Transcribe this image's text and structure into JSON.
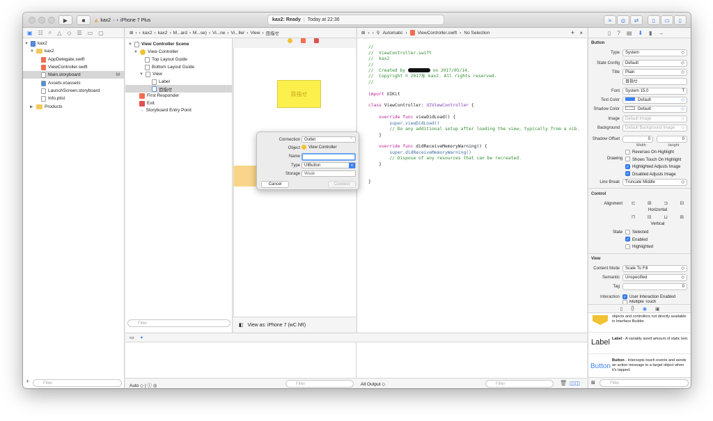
{
  "toolbar": {
    "scheme_app": "kax2",
    "scheme_device": "iPhone 7 Plus",
    "status_app": "kax2: Ready",
    "status_time": "Today at 22:36"
  },
  "navigator": {
    "items": [
      {
        "label": "kax2",
        "level": 0
      },
      {
        "label": "kax2",
        "level": 1
      },
      {
        "label": "AppDelegate.swift",
        "level": 2
      },
      {
        "label": "ViewController.swift",
        "level": 2
      },
      {
        "label": "Main.storyboard",
        "level": 2,
        "badge": "M"
      },
      {
        "label": "Assets.xcassets",
        "level": 2
      },
      {
        "label": "LaunchScreen.storyboard",
        "level": 2
      },
      {
        "label": "Info.plist",
        "level": 2
      },
      {
        "label": "Products",
        "level": 1
      }
    ],
    "filter_placeholder": "Filter"
  },
  "ib_jumpbar": [
    "kax2",
    "kax2",
    "M...ard",
    "M...se)",
    "Vi...ne",
    "Vi...ller",
    "View",
    "目指せ"
  ],
  "outline": {
    "scene": "View Controller Scene",
    "controller": "View Controller",
    "items": [
      "Top Layout Guide",
      "Bottom Layout Guide",
      "View",
      "Label",
      "目指せ",
      "First Responder",
      "Exit",
      "Storyboard Entry Point"
    ],
    "filter_placeholder": "Filter"
  },
  "canvas": {
    "button_text": "目指せ",
    "view_as": "View as: iPhone 7 (wC hR)"
  },
  "connection_dialog": {
    "labels": [
      "Connection",
      "Object",
      "Name",
      "Type",
      "Storage"
    ],
    "connection": "Outlet",
    "object": "View Controller",
    "name": "",
    "type": "UIButton",
    "storage": "Weak",
    "cancel": "Cancel",
    "connect": "Connect"
  },
  "editor": {
    "jumpbar_mode": "Automatic",
    "jumpbar_file": "ViewController.swift",
    "jumpbar_sel": "No Selection",
    "line_comment1": "//",
    "line_file": "//  ViewController.swift",
    "line_proj": "//  kax2",
    "line_comment2": "//",
    "line_created_a": "//  Created by",
    "line_created_b": "on 2017/05/14.",
    "line_copy": "//  Copyright © 2017年 kax2. All rights reserved.",
    "line_comment3": "//",
    "line_import_kw": "import",
    "line_import_mod": "UIKit",
    "line_class_kw": "class",
    "line_class_name": "ViewController:",
    "line_class_super": "UIViewController",
    "line_class_brace": "{",
    "line_vdl_kw": "override func",
    "line_vdl_name": "viewDidLoad()",
    "line_vdl_brace": "{",
    "line_vdl_super": "super.viewDidLoad()",
    "line_vdl_comment": "// Do any additional setup after loading the view, typically from a nib.",
    "line_close1": "}",
    "line_mem_kw": "override func",
    "line_mem_name": "didReceiveMemoryWarning()",
    "line_mem_brace": "{",
    "line_mem_super": "super.didReceiveMemoryWarning()",
    "line_mem_comment": "// Dispose of any resources that can be recreated.",
    "line_close2": "}",
    "line_close3": "}"
  },
  "debug": {
    "auto_label": "Auto",
    "output_label": "All Output",
    "filter_placeholder": "Filter"
  },
  "inspector": {
    "button_header": "Button",
    "type_label": "Type",
    "type_value": "System",
    "stateconfig_label": "State Config",
    "stateconfig_value": "Default",
    "title_label": "Title",
    "title_value": "Plain",
    "title_text": "目指せ",
    "font_label": "Font",
    "font_value": "System 15.0",
    "textcolor_label": "Text Color",
    "textcolor_value": "Default",
    "shadowcolor_label": "Shadow Color",
    "shadowcolor_value": "Default",
    "image_label": "Image",
    "image_value": "Default Image",
    "background_label": "Background",
    "background_value": "Default Background Image",
    "shadowoffset_label": "Shadow Offset",
    "shadow_w": "0",
    "shadow_h": "0",
    "width_label": "Width",
    "height_label": "Height",
    "drawing_label": "Drawing",
    "reverses": "Reverses On Highlight",
    "shows_touch": "Shows Touch On Highlight",
    "highlighted_adjusts": "Highlighted Adjusts Image",
    "disabled_adjusts": "Disabled Adjusts Image",
    "linebreak_label": "Line Break",
    "linebreak_value": "Truncate Middle",
    "control_header": "Control",
    "alignment_label": "Alignment",
    "horizontal_label": "Horizontal",
    "vertical_label": "Vertical",
    "state_label": "State",
    "selected": "Selected",
    "enabled": "Enabled",
    "highlighted": "Highlighted",
    "view_header": "View",
    "contentmode_label": "Content Mode",
    "contentmode_value": "Scale To Fill",
    "semantic_label": "Semantic",
    "semantic_value": "Unspecified",
    "tag_label": "Tag",
    "tag_value": "0",
    "interaction_label": "Interaction",
    "user_interaction": "User Interaction Enabled",
    "multiple_touch": "Multiple Touch"
  },
  "library": {
    "objects_text": "objects and controllers not directly available in Interface Builder.",
    "label_title": "Label",
    "label_name": "Label",
    "label_desc": "- A variably sized amount of static text.",
    "button_title": "Button",
    "button_name": "Button",
    "button_desc": "- Intercepts touch events and sends an action message to a target object when it's tapped.",
    "filter_placeholder": "Filter"
  },
  "colors": {
    "accent": "#3b82f6",
    "button_yellow": "#fbf04c",
    "button_text": "#c8a21b"
  }
}
